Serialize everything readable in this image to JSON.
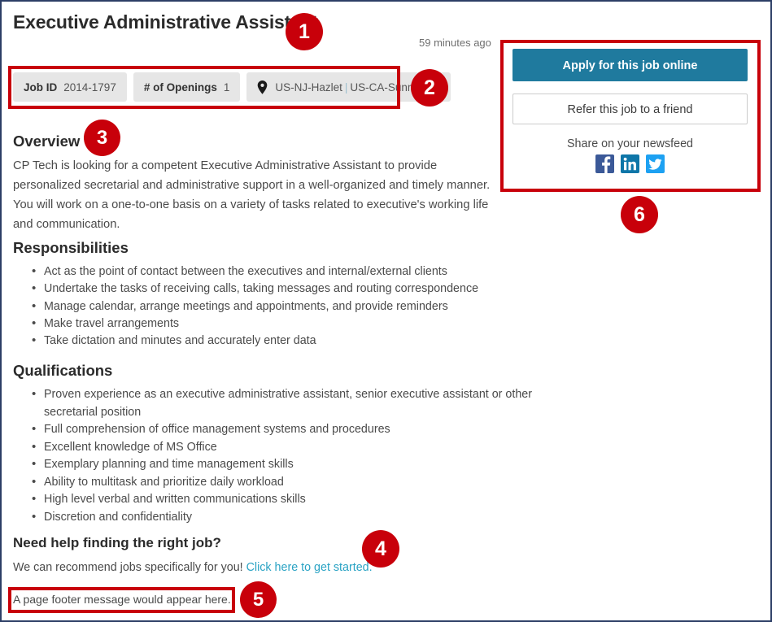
{
  "job": {
    "title": "Executive Administrative Assistant",
    "posted_time": "59 minutes ago",
    "meta": {
      "job_id_label": "Job ID",
      "job_id_value": "2014-1797",
      "openings_label": "# of Openings",
      "openings_value": "1",
      "location_primary": "US-NJ-Hazlet",
      "location_separator": "|",
      "location_secondary": "US-CA-Sunnydale",
      "location_icon": "map-pin-icon"
    }
  },
  "sections": {
    "overview": {
      "heading": "Overview",
      "body": "CP Tech is looking for a competent Executive Administrative Assistant to provide personalized secretarial and administrative support in a well-organized and timely manner. You will work on a one-to-one basis on a variety of tasks related to executive's working life and communication."
    },
    "responsibilities": {
      "heading": "Responsibilities",
      "items": [
        "Act as the point of contact between the executives and internal/external clients",
        "Undertake the tasks of receiving calls, taking messages and routing correspondence",
        "Manage calendar, arrange meetings and appointments, and provide reminders",
        "Make travel arrangements",
        "Take dictation and minutes and accurately enter data"
      ]
    },
    "qualifications": {
      "heading": "Qualifications",
      "items": [
        "Proven experience as an executive administrative assistant, senior executive assistant or other secretarial position",
        "Full comprehension of office management systems and procedures",
        "Excellent knowledge of MS Office",
        "Exemplary planning and time management skills",
        "Ability to multitask and prioritize daily workload",
        "High level verbal and written communications skills",
        "Discretion and confidentiality"
      ]
    },
    "need_help": {
      "heading": "Need help finding the right job?",
      "text_before_link": "We can recommend jobs specifically for you!",
      "link_text": "Click here to get started."
    }
  },
  "footer": {
    "message": "A page footer message would appear here."
  },
  "action_panel": {
    "apply_label": "Apply for this job online",
    "refer_label": "Refer this job to a friend",
    "share_label": "Share on your newsfeed",
    "social": [
      {
        "name": "facebook-icon",
        "color": "#3b5998"
      },
      {
        "name": "linkedin-icon",
        "color": "#0e76a8"
      },
      {
        "name": "twitter-icon",
        "color": "#1da1f2"
      }
    ]
  },
  "annotations": {
    "badges": [
      {
        "id": "1",
        "label": "1"
      },
      {
        "id": "2",
        "label": "2"
      },
      {
        "id": "3",
        "label": "3"
      },
      {
        "id": "4",
        "label": "4"
      },
      {
        "id": "5",
        "label": "5"
      },
      {
        "id": "6",
        "label": "6"
      }
    ],
    "highlight_color": "#c8000a"
  },
  "colors": {
    "accent_button": "#1f7a9e",
    "link": "#2aa3c4",
    "annotation_red": "#c8000a",
    "page_border": "#2c3e66",
    "pill_background": "#e6e6e6"
  }
}
